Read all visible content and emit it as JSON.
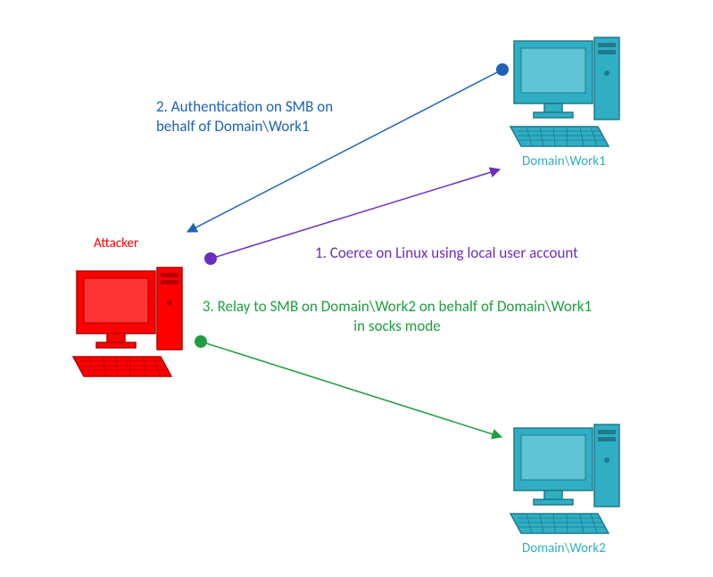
{
  "nodes": {
    "attacker": {
      "label": "Attacker",
      "color": "#FF0000"
    },
    "work1": {
      "label": "Domain\\Work1",
      "color": "#2FAEC4"
    },
    "work2": {
      "label": "Domain\\Work2",
      "color": "#2FAEC4"
    }
  },
  "steps": {
    "step1": {
      "text": "1. Coerce on Linux using local user account",
      "color": "#6B2FBE"
    },
    "step2": {
      "text": "2. Authentication on SMB on\nbehalf of Domain\\Work1",
      "color": "#2062B8"
    },
    "step3": {
      "text": "3. Relay to SMB on Domain\\Work2 on behalf of Domain\\Work1\nin socks mode",
      "color": "#1F9E3F"
    }
  },
  "colors": {
    "attacker_fill": "#FF0000",
    "attacker_stroke": "#B30000",
    "target_fill": "#2FAEC4",
    "target_stroke": "#1F7A8C"
  }
}
